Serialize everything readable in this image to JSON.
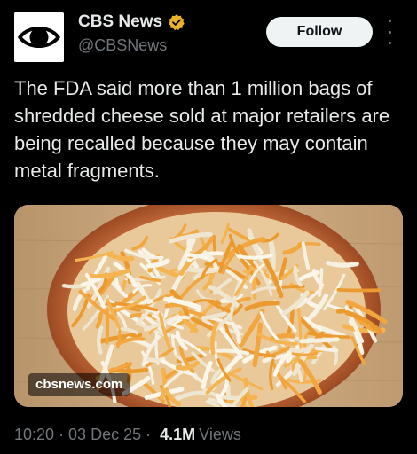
{
  "author": {
    "display_name": "CBS News",
    "handle": "@CBSNews",
    "verified": true,
    "verified_color": "#e8b22b",
    "avatar_icon": "cbs-eye-logo-icon"
  },
  "actions": {
    "follow_label": "Follow",
    "more_icon": "more-vertical-icon"
  },
  "post": {
    "text": "The FDA said more than 1 million bags of shredded cheese sold at major retailers are being recalled because they may contain metal fragments.",
    "media": {
      "watermark": "cbsnews.com"
    }
  },
  "meta": {
    "time": "10:20",
    "date": "03 Dec 25",
    "separator": "·",
    "views_count": "4.1M",
    "views_label": "Views"
  },
  "colors": {
    "background": "#000000",
    "primary_text": "#e7e9ea",
    "secondary_text": "#71767b",
    "follow_bg": "#eff3f4"
  }
}
